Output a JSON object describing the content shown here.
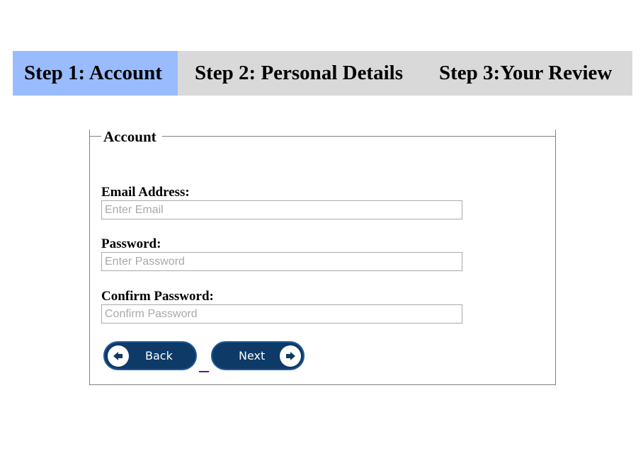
{
  "steps": [
    {
      "label": "Step 1: Account",
      "active": true
    },
    {
      "label": "Step 2: Personal Details",
      "active": false
    },
    {
      "label": "Step 3:Your Review",
      "active": false
    }
  ],
  "form": {
    "legend": "Account",
    "email": {
      "label": "Email Address:",
      "placeholder": "Enter Email",
      "value": ""
    },
    "password": {
      "label": "Password:",
      "placeholder": "Enter Password",
      "value": ""
    },
    "confirm": {
      "label": "Confirm Password:",
      "placeholder": "Confirm Password",
      "value": ""
    }
  },
  "buttons": {
    "back": {
      "label": "Back",
      "icon": "arrow-left-icon"
    },
    "next": {
      "label": "Next",
      "icon": "arrow-right-icon"
    }
  },
  "colors": {
    "active_step": "#99bbff",
    "step_bar": "#d9d9d9",
    "button_bg": "#0d3a66",
    "button_border": "#1e5a99"
  }
}
